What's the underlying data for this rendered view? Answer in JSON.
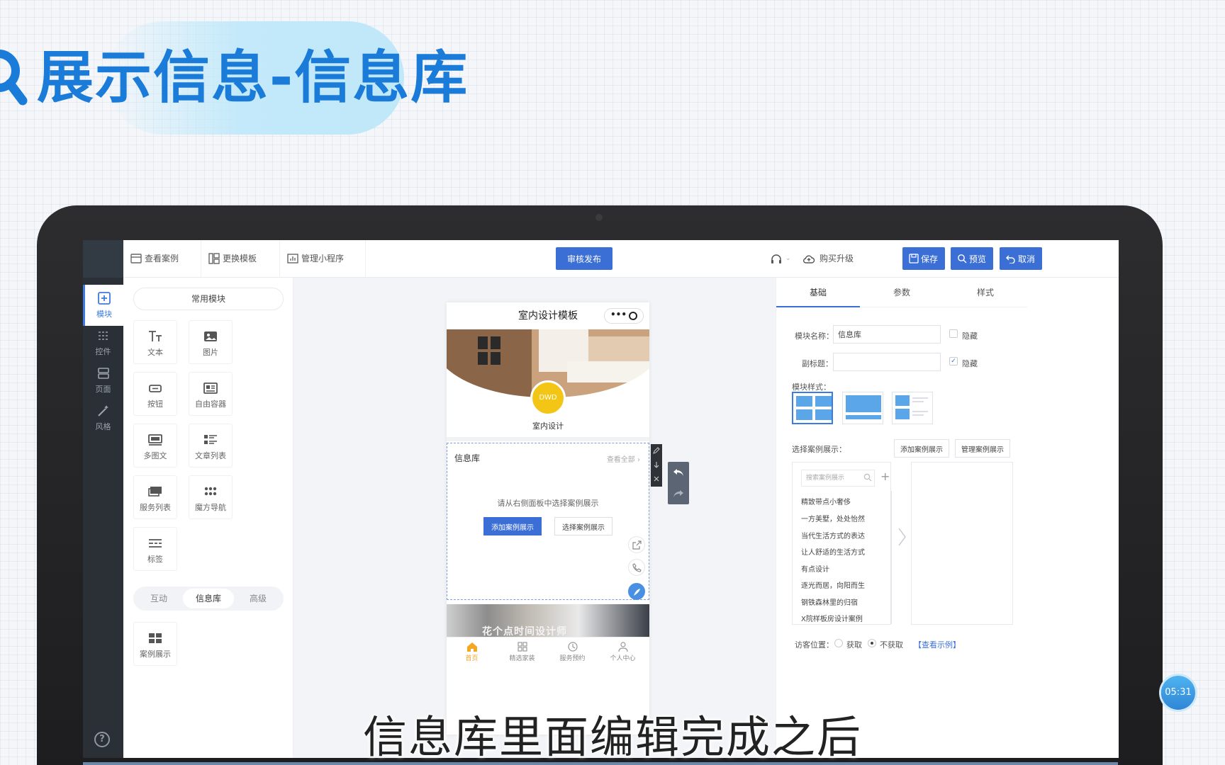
{
  "slide": {
    "title": "展示信息-信息库",
    "subtitle": "信息库里面编辑完成之后",
    "timer": "05:31"
  },
  "colors": {
    "accent": "#3c6fd6",
    "title_blue": "#1a7bd8",
    "rail_bg": "#2b2f36"
  },
  "rail": {
    "items": [
      {
        "label": "模块",
        "icon": "plus-square-icon"
      },
      {
        "label": "控件",
        "icon": "sliders-icon"
      },
      {
        "label": "页面",
        "icon": "layers-icon"
      },
      {
        "label": "风格",
        "icon": "magic-wand-icon"
      }
    ],
    "help": "?"
  },
  "toolbar": {
    "view_case": "查看案例",
    "change_template": "更换模板",
    "manage_miniprogram": "管理小程序",
    "publish": "审核发布",
    "buy_upgrade": "购买升级",
    "save": "保存",
    "preview": "预览",
    "cancel": "取消"
  },
  "modules": {
    "header": "常用模块",
    "tiles": [
      {
        "label": "文本",
        "icon": "text-icon"
      },
      {
        "label": "图片",
        "icon": "image-icon"
      },
      {
        "label": "按钮",
        "icon": "button-icon"
      },
      {
        "label": "自由容器",
        "icon": "container-icon"
      },
      {
        "label": "多图文",
        "icon": "multi-image-icon"
      },
      {
        "label": "文章列表",
        "icon": "article-list-icon"
      },
      {
        "label": "服务列表",
        "icon": "service-list-icon"
      },
      {
        "label": "魔方导航",
        "icon": "grid-nav-icon"
      },
      {
        "label": "标签",
        "icon": "tag-icon"
      }
    ],
    "segments": [
      "互动",
      "信息库",
      "高级"
    ],
    "case_tile": {
      "label": "案例展示",
      "icon": "case-grid-icon"
    }
  },
  "phone": {
    "title": "室内设计模板",
    "logo_text": "DWD",
    "brand": "室内设计",
    "info_title": "信息库",
    "view_all": "查看全部",
    "hint": "请从右侧面板中选择案例展示",
    "add_btn": "添加案例展示",
    "select_btn": "选择案例展示",
    "photo_text": "花个点时间设计师",
    "tabs": [
      {
        "label": "首页",
        "icon": "home-icon"
      },
      {
        "label": "精选家装",
        "icon": "grid-icon"
      },
      {
        "label": "服务预约",
        "icon": "clock-icon"
      },
      {
        "label": "个人中心",
        "icon": "user-icon"
      }
    ]
  },
  "props": {
    "tabs": [
      "基础",
      "参数",
      "样式"
    ],
    "module_name_label": "模块名称：",
    "module_name_value": "信息库",
    "hide": "隐藏",
    "subtitle_label": "副标题：",
    "style_label": "模块样式：",
    "select_label": "选择案例展示：",
    "add_btn": "添加案例展示",
    "manage_btn": "管理案例展示",
    "search_placeholder": "搜索案例展示",
    "items": [
      "精致带点小奢侈",
      "一方美墅，处处怡然",
      "当代生活方式的表达",
      "让人舒适的生活方式",
      "有点设计",
      "逐光而居，向阳而生",
      "钢铁森林里的归宿",
      "X院样板房设计案例"
    ],
    "visitor_label": "访客位置：",
    "opt_get": "获取",
    "opt_noget": "不获取",
    "example_link": "【查看示例】"
  }
}
